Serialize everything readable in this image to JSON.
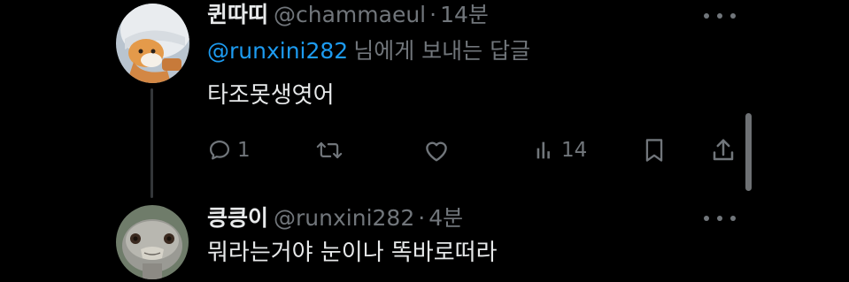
{
  "tweets": [
    {
      "display_name": "퀸따띠",
      "handle": "@chammaeul",
      "separator": "·",
      "timestamp": "14분",
      "reply_to_mention": "@runxini282",
      "reply_to_suffix": "님에게 보내는 답글",
      "text": "타조못생엿어",
      "avatar_icon": "cat-in-hat-avatar",
      "actions": {
        "reply_count": "1",
        "retweet_count": "",
        "like_count": "",
        "views_count": "14"
      }
    },
    {
      "display_name": "킁킁이",
      "handle": "@runxini282",
      "separator": "·",
      "timestamp": "4분",
      "text": "뭐라는거야 눈이나 똑바로떠라",
      "avatar_icon": "ostrich-avatar"
    }
  ],
  "colors": {
    "background": "#000000",
    "primary_text": "#e7e9ea",
    "secondary_text": "#71767b",
    "mention": "#1d9bf0",
    "thread_line": "#333639"
  },
  "icons": [
    "reply-icon",
    "retweet-icon",
    "like-icon",
    "views-icon",
    "bookmark-icon",
    "share-icon",
    "more-icon"
  ]
}
